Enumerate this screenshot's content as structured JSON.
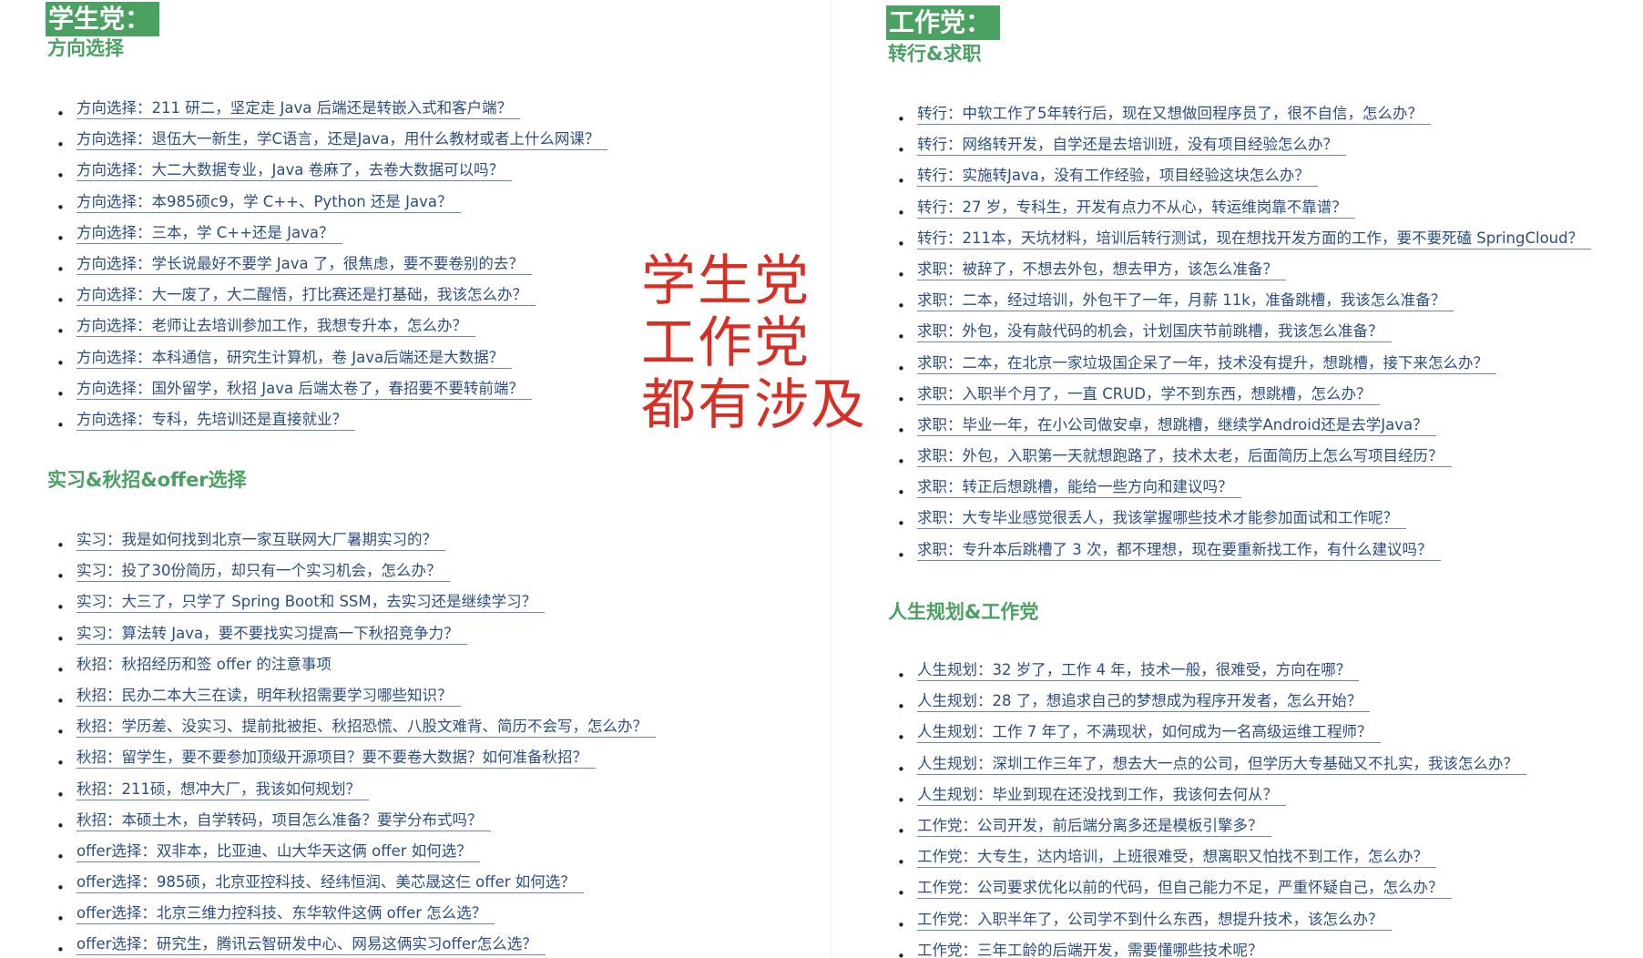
{
  "student": {
    "badge": "学生党：",
    "sections": [
      {
        "title": "方向选择",
        "items": [
          "方向选择：211 研二，坚定走 Java 后端还是转嵌入式和客户端？",
          "方向选择：退伍大一新生，学C语言，还是Java，用什么教材或者上什么网课？",
          "方向选择：大二大数据专业，Java 卷麻了，去卷大数据可以吗？",
          "方向选择：本985硕c9，学 C++、Python 还是 Java？",
          "方向选择：三本，学 C++还是 Java？",
          "方向选择：学长说最好不要学 Java 了，很焦虑，要不要卷别的去？",
          "方向选择：大一废了，大二醒悟，打比赛还是打基础，我该怎么办？",
          "方向选择：老师让去培训参加工作，我想专升本，怎么办？",
          "方向选择：本科通信，研究生计算机，卷 Java后端还是大数据？",
          "方向选择：国外留学，秋招 Java 后端太卷了，春招要不要转前端？",
          "方向选择：专科，先培训还是直接就业？"
        ]
      },
      {
        "title": "实习&秋招&offer选择",
        "items": [
          "实习：我是如何找到北京一家互联网大厂暑期实习的？",
          "实习：投了30份简历，却只有一个实习机会，怎么办？",
          "实习：大三了，只学了 Spring Boot和 SSM，去实习还是继续学习？",
          "实习：算法转 Java，要不要找实习提高一下秋招竞争力？",
          "秋招：秋招经历和签 offer 的注意事项",
          "秋招：民办二本大三在读，明年秋招需要学习哪些知识？",
          "秋招：学历差、没实习、提前批被拒、秋招恐慌、八股文难背、简历不会写，怎么办？",
          "秋招：留学生，要不要参加顶级开源项目？要不要卷大数据？如何准备秋招？",
          "秋招：211硕，想冲大厂，我该如何规划？",
          "秋招：本硕土木，自学转码，项目怎么准备？要学分布式吗？",
          "offer选择：双非本，比亚迪、山大华天这俩 offer 如何选？",
          "offer选择：985硕，北京亚控科技、经纬恒润、美芯晟这仨 offer 如何选？",
          "offer选择：北京三维力控科技、东华软件这俩 offer 怎么选？",
          "offer选择：研究生，腾讯云智研发中心、网易这俩实习offer怎么选？"
        ]
      }
    ]
  },
  "worker": {
    "badge": "工作党：",
    "sections": [
      {
        "title": "转行&求职",
        "items": [
          "转行：中软工作了5年转行后，现在又想做回程序员了，很不自信，怎么办？",
          "转行：网络转开发，自学还是去培训班，没有项目经验怎么办？",
          "转行：实施转Java，没有工作经验，项目经验这块怎么办？",
          "转行：27 岁，专科生，开发有点力不从心，转运维岗靠不靠谱？",
          "转行：211本，天坑材料，培训后转行测试，现在想找开发方面的工作，要不要死磕 SpringCloud？",
          "求职：被辞了，不想去外包，想去甲方，该怎么准备？",
          "求职：二本，经过培训，外包干了一年，月薪 11k，准备跳槽，我该怎么准备？",
          "求职：外包，没有敲代码的机会，计划国庆节前跳槽，我该怎么准备？",
          "求职：二本，在北京一家垃圾国企呆了一年，技术没有提升，想跳槽，接下来怎么办？",
          "求职：入职半个月了，一直 CRUD，学不到东西，想跳槽，怎么办？",
          "求职：毕业一年，在小公司做安卓，想跳槽，继续学Android还是去学Java？",
          "求职：外包，入职第一天就想跑路了，技术太老，后面简历上怎么写项目经历？",
          "求职：转正后想跳槽，能给一些方向和建议吗？",
          "求职：大专毕业感觉很丢人，我该掌握哪些技术才能参加面试和工作呢？",
          "求职：专升本后跳槽了 3 次，都不理想，现在要重新找工作，有什么建议吗？"
        ]
      },
      {
        "title": "人生规划&工作党",
        "items": [
          "人生规划：32 岁了，工作 4 年，技术一般，很难受，方向在哪？",
          "人生规划：28 了，想追求自己的梦想成为程序开发者，怎么开始？",
          "人生规划：工作 7 年了，不满现状，如何成为一名高级运维工程师？",
          "人生规划：深圳工作三年了，想去大一点的公司，但学历大专基础又不扎实，我该怎么办？",
          "人生规划：毕业到现在还没找到工作，我该何去何从？",
          "工作党：公司开发，前后端分离多还是模板引擎多？",
          "工作党：大专生，达内培训，上班很难受，想离职又怕找不到工作，怎么办？",
          "工作党：公司要求优化以前的代码，但自己能力不足，严重怀疑自己，怎么办？",
          "工作党：入职半年了，公司学不到什么东西，想提升技术，该怎么办？",
          "工作党：三年工龄的后端开发，需要懂哪些技术呢？"
        ]
      }
    ]
  },
  "note": {
    "line1": "学生党",
    "line2": "工作党",
    "line3": "都有涉及"
  }
}
